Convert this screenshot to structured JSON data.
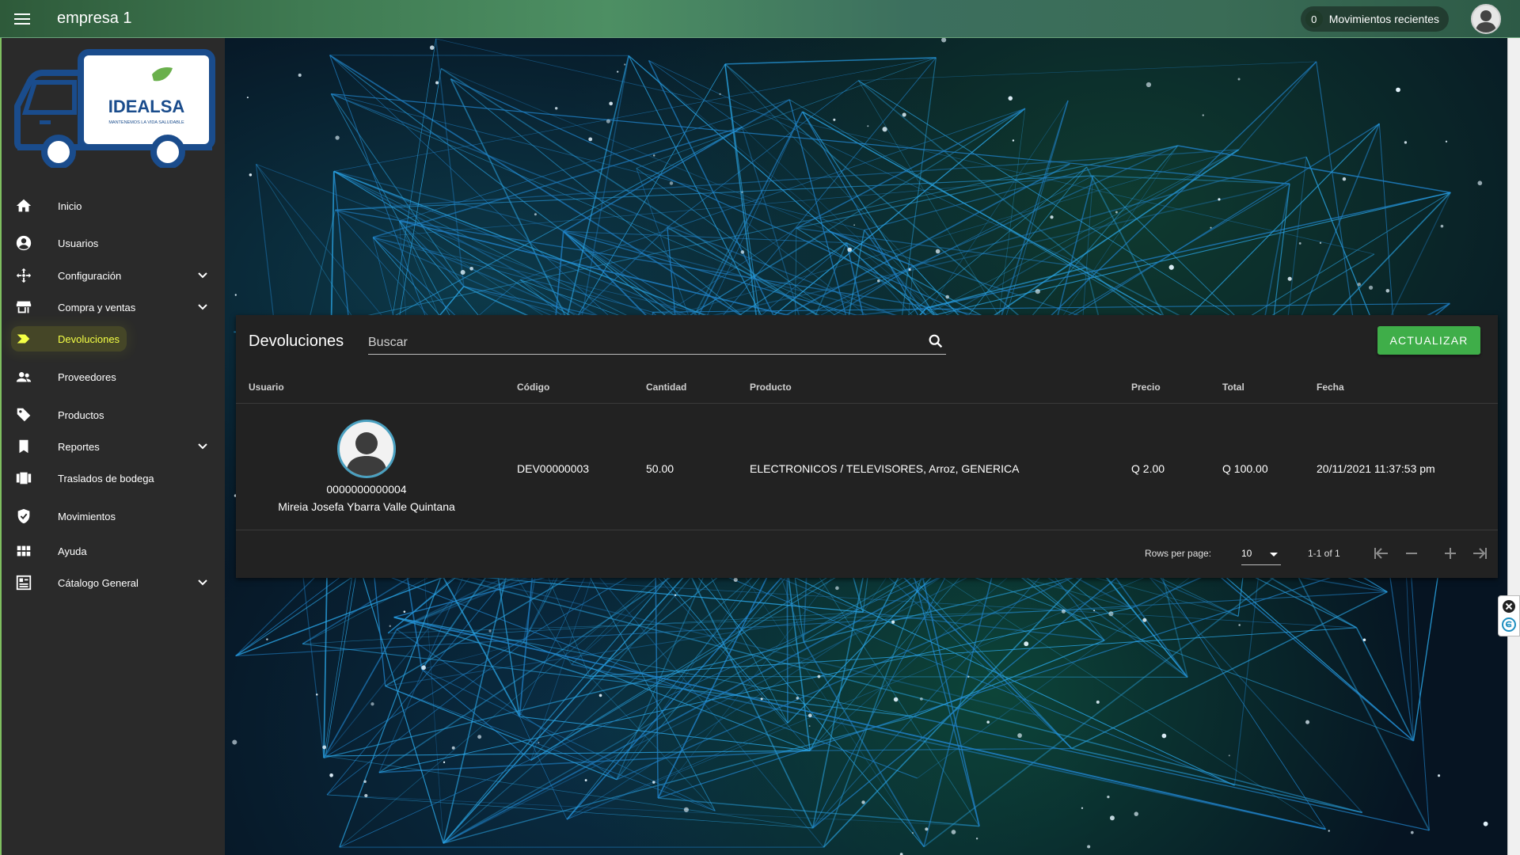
{
  "header": {
    "title": "empresa 1",
    "recent_count": "0",
    "recent_label": "Movimientos recientes"
  },
  "logo": {
    "brand": "IDEALSA",
    "tagline": "MANTENEMOS LA VIDA SALUDABLE"
  },
  "sidebar": {
    "items": [
      {
        "label": "Inicio",
        "icon": "home-icon",
        "expandable": false
      },
      {
        "label": "Usuarios",
        "icon": "account-circle-icon",
        "expandable": false
      },
      {
        "label": "Configuración",
        "icon": "move-arrows-icon",
        "expandable": true
      },
      {
        "label": "Compra y ventas",
        "icon": "store-icon",
        "expandable": true
      },
      {
        "label": "Devoluciones",
        "icon": "label-arrow-icon",
        "expandable": false,
        "active": true
      },
      {
        "label": "Proveedores",
        "icon": "people-icon",
        "expandable": false
      },
      {
        "label": "Productos",
        "icon": "tag-icon",
        "expandable": false
      },
      {
        "label": "Reportes",
        "icon": "bookmark-icon",
        "expandable": true
      },
      {
        "label": "Traslados de bodega",
        "icon": "view-carousel-icon",
        "expandable": false
      },
      {
        "label": "Movimientos",
        "icon": "verified-shield-icon",
        "expandable": false
      },
      {
        "label": "Ayuda",
        "icon": "grid-icon",
        "expandable": false
      },
      {
        "label": "Cátalogo General",
        "icon": "catalog-icon",
        "expandable": true
      }
    ]
  },
  "card": {
    "title": "Devoluciones",
    "search_placeholder": "Buscar",
    "refresh_label": "ACTUALIZAR",
    "columns": [
      "Usuario",
      "Código",
      "Cantidad",
      "Producto",
      "Precio",
      "Total",
      "Fecha"
    ],
    "rows": [
      {
        "user_code": "0000000000004",
        "user_name": "Mireia Josefa Ybarra Valle Quintana",
        "codigo": "DEV00000003",
        "cantidad": "50.00",
        "producto": "ELECTRONICOS / TELEVISORES, Arroz, GENERICA",
        "precio": "Q 2.00",
        "total": "Q 100.00",
        "fecha": "20/11/2021 11:37:53 pm"
      }
    ],
    "footer": {
      "rows_per_page_label": "Rows per page:",
      "rows_per_page_value": "10",
      "range": "1-1 of 1"
    }
  },
  "colors": {
    "accent_green": "#3fae49",
    "sidebar_bg": "#2a2a2a",
    "card_bg": "#222222",
    "active_highlight": "#e8f21a"
  }
}
